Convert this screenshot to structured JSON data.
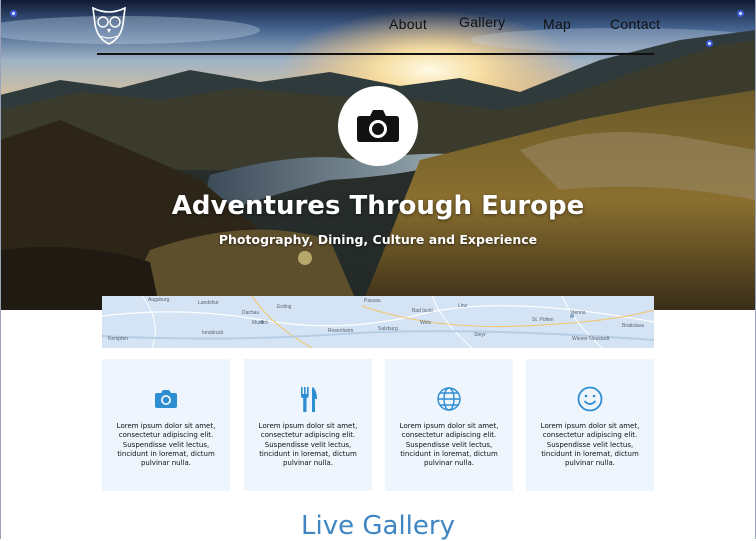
{
  "nav": {
    "items": [
      "About",
      "Gallery",
      "Map",
      "Contact"
    ]
  },
  "hero": {
    "title": "Adventures Through Europe",
    "subtitle": "Photography, Dining, Culture and Experience"
  },
  "map": {
    "labels": [
      "Augsburg",
      "Erding",
      "Dachau",
      "Munich",
      "Rosenheim",
      "Salzburg",
      "Bad Ischl",
      "Linz",
      "St. Pölten",
      "Vienna",
      "Bratislava",
      "Kempten",
      "Innsbruck",
      "Landshut",
      "Passau",
      "Wels",
      "Steyr",
      "Wiener Neustadt"
    ]
  },
  "cards": [
    {
      "icon": "camera-icon",
      "text": "Lorem ipsum dolor sit amet, consectetur adipiscing elit. Suspendisse velit lectus, tincidunt in loremat, dictum pulvinar nulla."
    },
    {
      "icon": "fork-knife-icon",
      "text": "Lorem ipsum dolor sit amet, consectetur adipiscing elit. Suspendisse velit lectus, tincidunt in loremat, dictum pulvinar nulla."
    },
    {
      "icon": "globe-icon",
      "text": "Lorem ipsum dolor sit amet, consectetur adipiscing elit. Suspendisse velit lectus, tincidunt in loremat, dictum pulvinar nulla."
    },
    {
      "icon": "smiley-icon",
      "text": "Lorem ipsum dolor sit amet, consectetur adipiscing elit. Suspendisse velit lectus, tincidunt in loremat, dictum pulvinar nulla."
    }
  ],
  "section": {
    "live_gallery": "Live Gallery"
  },
  "colors": {
    "accent": "#3f86c3",
    "card_bg": "#eef5fc",
    "icon": "#2f8dd1"
  }
}
